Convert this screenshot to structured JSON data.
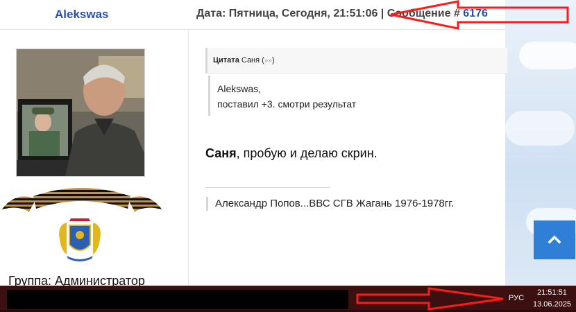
{
  "header": {
    "author": "Alekswas",
    "meta_prefix": "Дата: Пятница, Сегодня, 21:51:06 | Сообщение # ",
    "message_number": "6176"
  },
  "sidebar": {
    "group": "Группа: Администратор"
  },
  "quote": {
    "label": "Цитата",
    "author": "Саня",
    "open_paren": " (",
    "arrows": "»»",
    "close_paren": ")",
    "line1": "Alekswas,",
    "line2": "поставил +3. смотри результат"
  },
  "post": {
    "name": "Саня",
    "rest": ", пробую и делаю скрин."
  },
  "signature": "Александр Попов...ВВС СГВ Жагань 1976-1978гг.",
  "taskbar": {
    "lang": "РУС",
    "time": "21:51:51",
    "date": "13.06.2025"
  },
  "colors": {
    "link": "#2a4fb3",
    "annotation": "#ff1a1a",
    "scroll_button": "#2f7fd6",
    "taskbar": "#3c1010"
  },
  "icons": {
    "scroll_top": "chevron-up-icon",
    "quote_link": "double-arrow-icon"
  }
}
